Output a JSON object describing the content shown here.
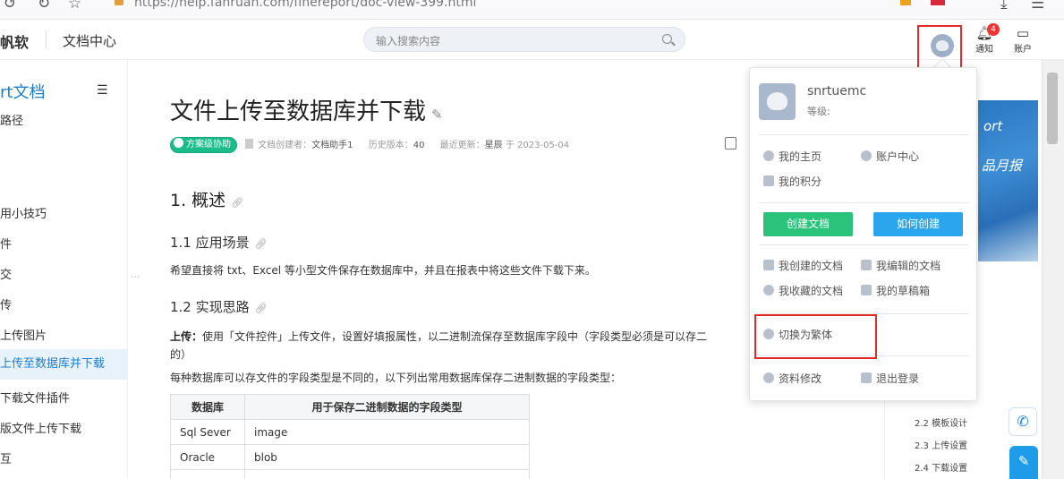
{
  "browser": {
    "url": "https://help.fanruan.com/finereport/doc-view-399.html"
  },
  "header": {
    "logo": "帆软",
    "section_title": "文档中心",
    "search_placeholder": "输入搜索内容",
    "notify_label": "通知",
    "notify_count": "4",
    "account_label": "账户"
  },
  "sidebar": {
    "title": "rt文档",
    "items": [
      {
        "label": "路径"
      },
      {
        "label": "用小技巧"
      },
      {
        "label": "件"
      },
      {
        "label": "交"
      },
      {
        "label": "传"
      },
      {
        "label": "上传图片"
      },
      {
        "label": "上传至数据库并下载"
      },
      {
        "label": "下载文件插件"
      },
      {
        "label": "版文件上传下载"
      },
      {
        "label": "互"
      }
    ]
  },
  "doc": {
    "title": "文件上传至数据库并下载",
    "badge": "方案级协助",
    "creator_label": "文档创建者：",
    "creator": "文档助手1",
    "version_label": "历史版本：",
    "version": "40",
    "updated_label": "最近更新：",
    "updater": "星辰",
    "updated_date": "于 2023-05-04",
    "h1": "1. 概述",
    "h2_scene": "1.1 应用场景",
    "scene_text": "希望直接将 txt、Excel 等小型文件保存在数据库中，并且在报表中将这些文件下载下来。",
    "h2_idea": "1.2 实现思路",
    "upload_label": "上传：",
    "upload_text": "使用「文件控件」上传文件，设置好填报属性，以二进制流保存至数据库字段中（字段类型必须是可以存二",
    "upload_text2": "的）",
    "db_note": "每种数据库可以存文件的字段类型是不同的，以下列出常用数据库保存二进制数据的字段类型：",
    "table": {
      "headers": [
        "数据库",
        "用于保存二进制数据的字段类型"
      ],
      "rows": [
        [
          "Sql Sever",
          "image"
        ],
        [
          "Oracle",
          "blob"
        ],
        [
          "",
          ""
        ]
      ]
    }
  },
  "promo": {
    "line1": "ort",
    "line2": "品月报"
  },
  "toc": [
    {
      "label": "2.2 模板设计"
    },
    {
      "label": "2.3 上传设置"
    },
    {
      "label": "2.4 下载设置"
    }
  ],
  "panel": {
    "username": "snrtuemc",
    "level_label": "等级:",
    "my_home": "我的主页",
    "account_center": "账户中心",
    "my_points": "我的积分",
    "create_doc": "创建文档",
    "how_create": "如何创建",
    "my_created": "我创建的文档",
    "my_edited": "我编辑的文档",
    "my_fav": "我收藏的文档",
    "my_drafts": "我的草稿箱",
    "switch_trad": "切换为繁体",
    "edit_profile": "资料修改",
    "logout": "退出登录"
  },
  "colors": {
    "accent": "#1e7ec8",
    "highlight": "#e02b2b",
    "green_button": "#2bc27a",
    "blue_button": "#2aa6ee"
  }
}
